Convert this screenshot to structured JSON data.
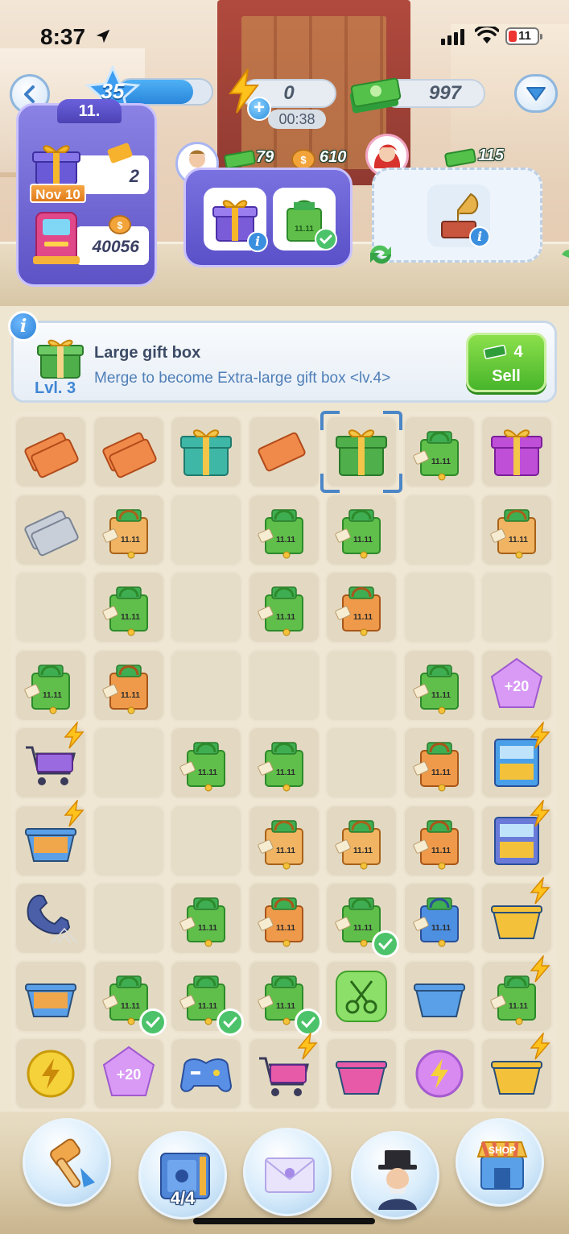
{
  "status_bar": {
    "time": "8:37",
    "battery": "11"
  },
  "hud": {
    "player_level": "35",
    "level_progress": 0.8,
    "energy_value": "0",
    "energy_timer": "00:38",
    "cash_value": "997"
  },
  "event": {
    "tag": "11.",
    "date": "Nov 10",
    "tickets": "2",
    "coins": "40056"
  },
  "orders": [
    {
      "customer": "businessman",
      "cash": "79",
      "coins": "610",
      "items": [
        "gift-box-order",
        "shopping-bag-order"
      ],
      "completed": [
        false,
        true
      ]
    },
    {
      "customer": "red-haired-woman",
      "cash": "115",
      "items": [
        "gramophone-order"
      ]
    }
  ],
  "info_banner": {
    "title": "Large gift box",
    "level": "Lvl. 3",
    "description": "Merge to become Extra-large gift box <lv.4>",
    "sell_price": "4",
    "sell_label": "Sell"
  },
  "board": {
    "columns": 7,
    "rows": 9,
    "selected": [
      0,
      4
    ],
    "cells": [
      [
        "ticket-orange-2",
        "ticket-orange",
        "gift-box-teal",
        "ticket-torn",
        "gift-box-green",
        "bag-green",
        "gift-box-purple"
      ],
      [
        "ticket-silver",
        "bag-tan",
        "",
        "bag-green",
        "bag-green",
        "",
        "bag-tan"
      ],
      [
        "",
        "bag-green",
        "",
        "bag-green",
        "bag-orange",
        "",
        ""
      ],
      [
        "bag-green",
        "bag-orange",
        "",
        "",
        "",
        "bag-green",
        "gem-20"
      ],
      [
        "cart-bolt",
        "",
        "bag-green",
        "bag-green",
        "",
        "bag-orange",
        "cabinet-bolt"
      ],
      [
        "box-open-bolt",
        "",
        "",
        "bag-tan",
        "bag-tan",
        "bag-orange",
        "shelf-bolt"
      ],
      [
        "phone-cobweb",
        "",
        "bag-green",
        "bag-orange",
        "bag-green-check",
        "bag-blue",
        "basket-bolt"
      ],
      [
        "box-open",
        "bag-green-check",
        "bag-green-check",
        "bag-green-check",
        "scissors",
        "tray-blue",
        "bag-red-bolt"
      ],
      [
        "coin-energy",
        "gem-20",
        "gamepad",
        "cart-pink-bolt",
        "basket-pink",
        "energy-orb",
        "basket-yellow-bolt"
      ]
    ],
    "gem_label": "+20"
  },
  "bottom_nav": [
    {
      "name": "hammer",
      "count": ""
    },
    {
      "name": "safe",
      "count": "4/4"
    },
    {
      "name": "mail",
      "count": ""
    },
    {
      "name": "tycoon",
      "count": ""
    },
    {
      "name": "shop",
      "count": ""
    }
  ],
  "colors": {
    "accent_blue": "#2a86db",
    "panel_purple": "#5d53c6",
    "sell_green": "#48b52b",
    "board_bg": "#efe6d3"
  }
}
